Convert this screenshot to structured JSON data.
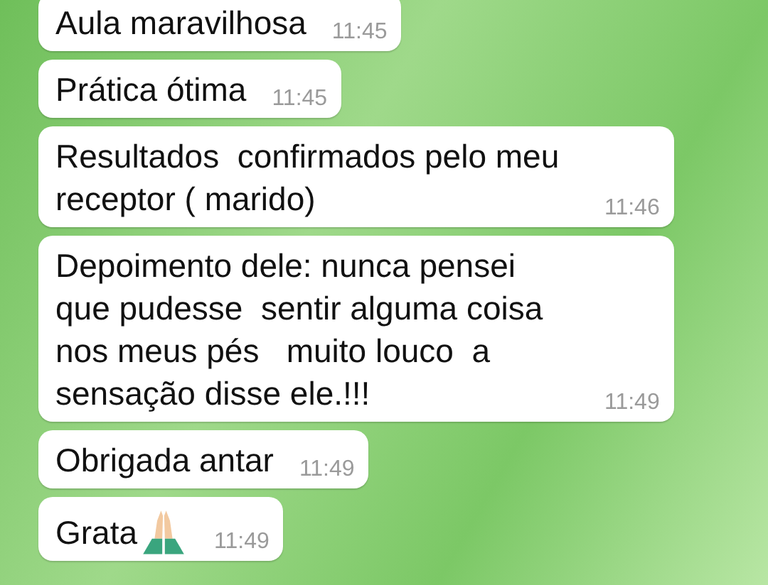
{
  "messages": [
    {
      "text": "Aula maravilhosa",
      "time": "11:45",
      "kind": "text"
    },
    {
      "text": "Prática ótima",
      "time": "11:45",
      "kind": "text"
    },
    {
      "text": "Resultados  confirmados pelo meu receptor ( marido)",
      "time": "11:46",
      "kind": "text"
    },
    {
      "text": "Depoimento dele: nunca pensei  que pudesse  sentir alguma coisa nos meus pés   muito louco  a sensação disse ele.!!!",
      "time": "11:49",
      "kind": "text"
    },
    {
      "text": "Obrigada antar",
      "time": "11:49",
      "kind": "text"
    },
    {
      "text": "Grata",
      "time": "11:49",
      "kind": "emoji"
    }
  ]
}
